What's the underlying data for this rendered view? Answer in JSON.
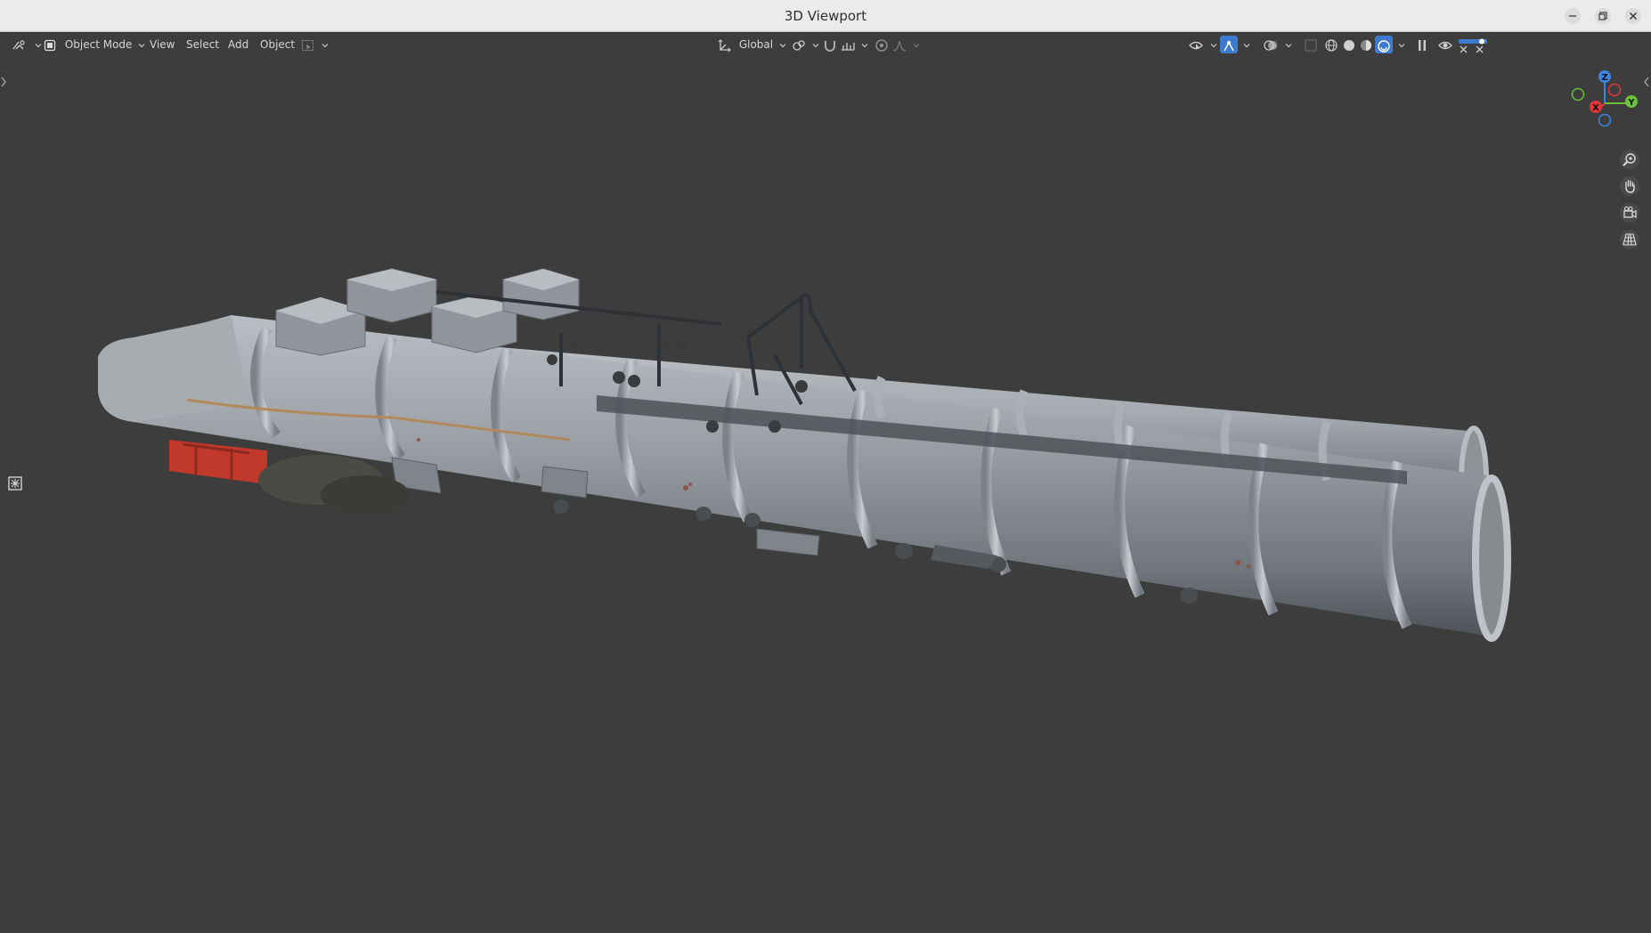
{
  "window": {
    "title": "3D Viewport"
  },
  "header": {
    "mode_label": "Object Mode",
    "menus": [
      "View",
      "Select",
      "Add",
      "Object"
    ],
    "orientation_label": "Global"
  },
  "gizmo": {
    "z": "Z",
    "y": "Y",
    "x": "X"
  },
  "icons": {
    "editor_type": "editor-type-icon",
    "object_mode": "object-mode-icon",
    "transform_orientation": "axis-icon",
    "pivot": "link-icon",
    "snap": "magnet-icon",
    "proportional": "proportional-edit-icon",
    "visibility": "eye-icon",
    "overlays": "overlay-icon",
    "xray": "xray-icon",
    "shading": [
      "wireframe-icon",
      "solid-icon",
      "material-icon",
      "rendered-icon"
    ]
  },
  "colors": {
    "accent": "#3d7bd0",
    "x_axis": "#e2363b",
    "y_axis": "#6ac23b",
    "z_axis": "#3b86e0",
    "viewport_bg": "#3d3d3d"
  }
}
